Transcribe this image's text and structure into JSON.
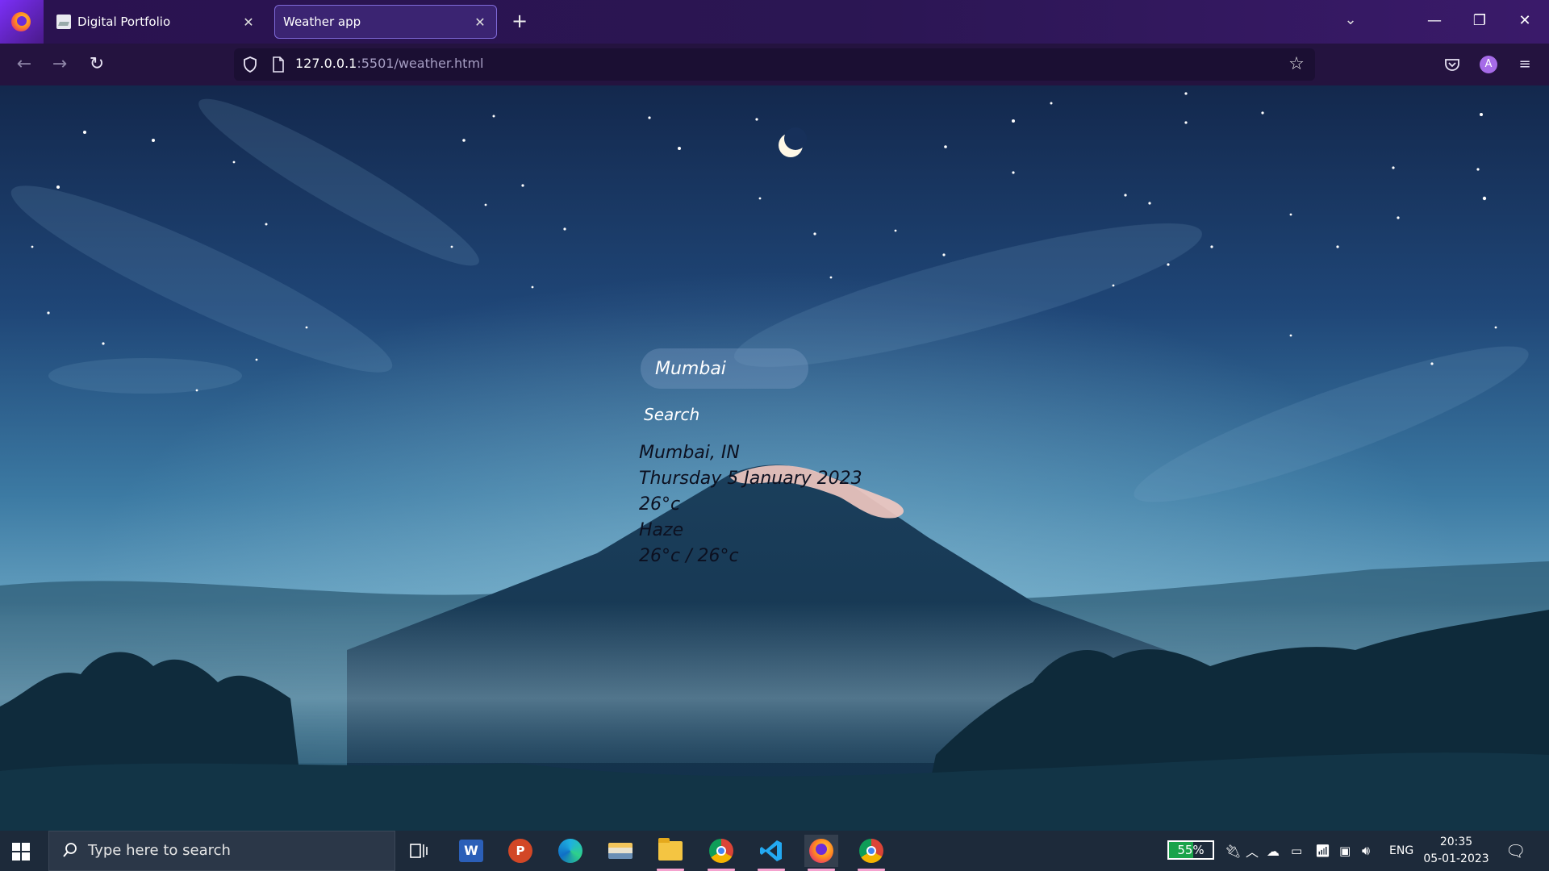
{
  "browser": {
    "tabs": [
      {
        "title": "Digital Portfolio",
        "active": false
      },
      {
        "title": "Weather app",
        "active": true
      }
    ],
    "url_host": "127.0.0.1",
    "url_path": ":5501/weather.html"
  },
  "weather_app": {
    "search_value": "Mumbai",
    "search_button": "Search",
    "location": "Mumbai, IN",
    "date": "Thursday 5 January 2023",
    "temperature": "26°c",
    "condition": "Haze",
    "hi_lo": "26°c / 26°c"
  },
  "taskbar": {
    "search_placeholder": "Type here to search",
    "battery_percent": "55%",
    "battery_level": 0.55,
    "language": "ENG",
    "time": "20:35",
    "date": "05-01-2023"
  },
  "colors": {
    "tab_bar": "#2b1653",
    "nav_bar": "#24133f",
    "taskbar": "#1d2a3a",
    "weather_text": "#0c1020"
  }
}
